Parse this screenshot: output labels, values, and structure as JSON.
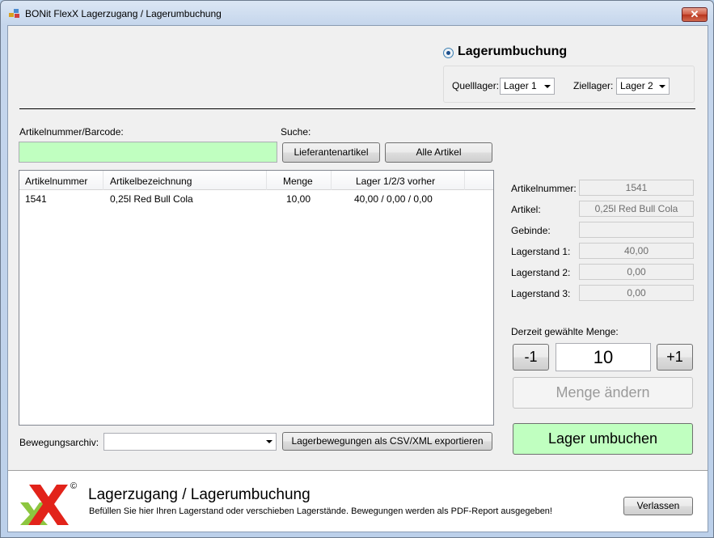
{
  "window": {
    "title": "BONit FlexX Lagerzugang / Lagerumbuchung",
    "close_glyph": "✕"
  },
  "transfer": {
    "radio_label": "Lagerumbuchung",
    "source_label": "Quelllager:",
    "source_value": "Lager 1",
    "target_label": "Ziellager:",
    "target_value": "Lager 2"
  },
  "search": {
    "article_label": "Artikelnummer/Barcode:",
    "article_value": "",
    "search_label": "Suche:",
    "supplier_button": "Lieferantenartikel",
    "all_button": "Alle Artikel"
  },
  "table": {
    "columns": [
      "Artikelnummer",
      "Artikelbezeichnung",
      "Menge",
      "Lager 1/2/3 vorher"
    ],
    "rows": [
      {
        "number": "1541",
        "name": "0,25l Red Bull Cola",
        "qty": "10,00",
        "stock": "40,00 / 0,00 / 0,00"
      }
    ]
  },
  "details": {
    "fields": [
      {
        "label": "Artikelnummer:",
        "value": "1541"
      },
      {
        "label": "Artikel:",
        "value": "0,25l Red Bull Cola"
      },
      {
        "label": "Gebinde:",
        "value": ""
      },
      {
        "label": "Lagerstand 1:",
        "value": "40,00"
      },
      {
        "label": "Lagerstand 2:",
        "value": "0,00"
      },
      {
        "label": "Lagerstand 3:",
        "value": "0,00"
      }
    ],
    "qty_label": "Derzeit gewählte Menge:",
    "minus_button": "-1",
    "qty_value": "10",
    "plus_button": "+1",
    "change_button": "Menge ändern",
    "transfer_button": "Lager umbuchen"
  },
  "archive": {
    "label": "Bewegungsarchiv:",
    "value": "",
    "export_button": "Lagerbewegungen als CSV/XML exportieren"
  },
  "footer": {
    "logo_mark": "©",
    "title": "Lagerzugang / Lagerumbuchung",
    "subtitle": "Befüllen Sie hier Ihren Lagerstand oder verschieben Lagerstände. Bewegungen werden als PDF-Report ausgegeben!",
    "exit_button": "Verlassen"
  },
  "colors": {
    "barcode_bg": "#c0ffc0",
    "transfer_button_bg": "#c0ffc0",
    "logo_green": "#8dc63f",
    "logo_red": "#e2231a"
  }
}
